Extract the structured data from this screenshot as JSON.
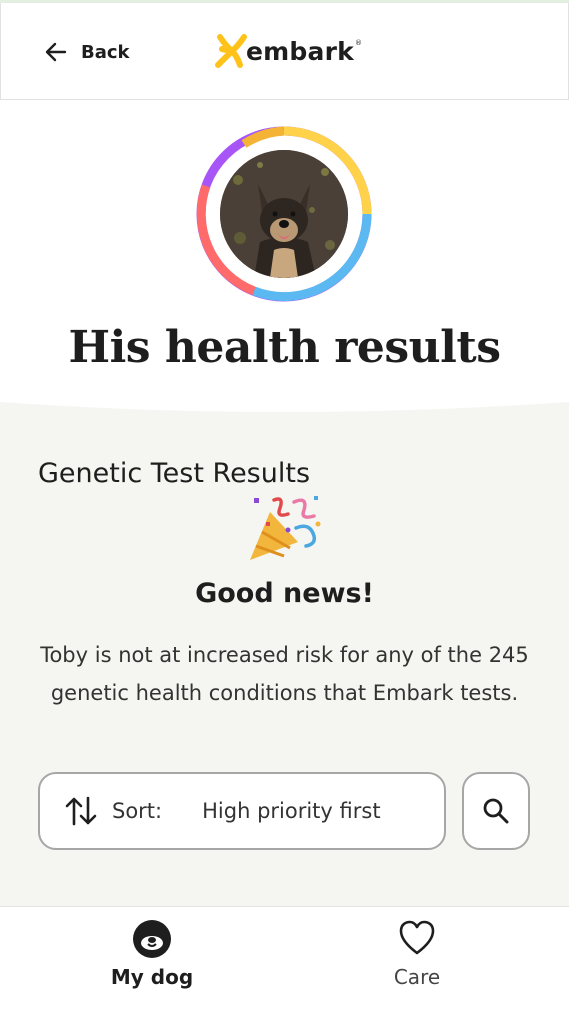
{
  "header": {
    "back_label": "Back",
    "logo_text": "embark",
    "logo_mark": "®"
  },
  "avatar": {
    "ring_colors": [
      "#f5b335",
      "#ffd24a",
      "#5bb8f0",
      "#ff6b6b",
      "#a855f7"
    ],
    "photo": "dog-photo"
  },
  "page": {
    "title": "His health results"
  },
  "results": {
    "section_title": "Genetic Test Results",
    "celebration_icon": "party-popper-icon",
    "headline": "Good news!",
    "description": "Toby is not at increased risk for any of the 245 genetic health conditions that Embark tests."
  },
  "sort": {
    "label": "Sort:",
    "value": "High priority first"
  },
  "nav": {
    "items": [
      {
        "label": "My dog",
        "icon": "dog-face-icon",
        "active": true
      },
      {
        "label": "Care",
        "icon": "heart-icon",
        "active": false
      }
    ]
  },
  "colors": {
    "panel_bg": "#f5f5f1",
    "accent_yellow": "#ffc21a",
    "border": "#a6a6a6"
  }
}
